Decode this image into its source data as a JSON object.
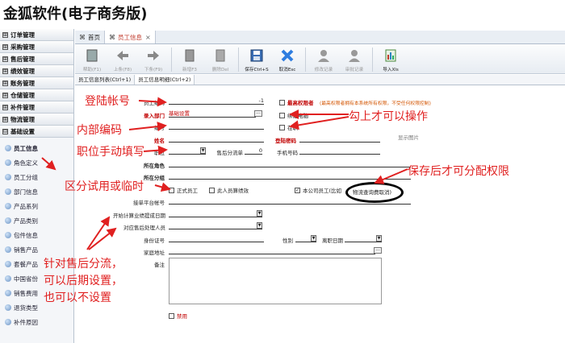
{
  "app_title": "金狐软件(电子商务版)",
  "sidebar": {
    "menus": [
      {
        "label": "订单管理",
        "sign": "⊞"
      },
      {
        "label": "采购管理",
        "sign": "⊞"
      },
      {
        "label": "售后管理",
        "sign": "⊞"
      },
      {
        "label": "绩效管理",
        "sign": "⊞"
      },
      {
        "label": "账务管理",
        "sign": "⊞"
      },
      {
        "label": "仓储管理",
        "sign": "⊞"
      },
      {
        "label": "补件管理",
        "sign": "⊞"
      },
      {
        "label": "物流管理",
        "sign": "⊞"
      },
      {
        "label": "基础设置",
        "sign": "⊟"
      }
    ],
    "sub_items": [
      "员工信息",
      "角色定义",
      "员工分组",
      "部门信息",
      "产品系列",
      "产品类别",
      "包件信息",
      "销售产品",
      "套餐产品",
      "中国省份",
      "销售费用",
      "退货类型",
      "补件原因"
    ]
  },
  "tabs": [
    {
      "label": "首页",
      "icon": "⌘",
      "active": false
    },
    {
      "label": "员工信息",
      "icon": "⌘",
      "active": true,
      "close": "×"
    }
  ],
  "toolbar": [
    {
      "label": "帮助(F1)",
      "icon": "help-book-icon",
      "enabled": false
    },
    {
      "label": "上条(F8)",
      "icon": "arrow-left-icon",
      "enabled": false
    },
    {
      "label": "下条(F9)",
      "icon": "arrow-right-icon",
      "enabled": false
    },
    {
      "label": "新增F3",
      "icon": "new-document-icon",
      "enabled": false
    },
    {
      "label": "删除Del",
      "icon": "delete-document-icon",
      "enabled": false
    },
    {
      "label": "保存Ctrl+S",
      "icon": "save-disk-icon",
      "enabled": true
    },
    {
      "label": "取消Esc",
      "icon": "cancel-x-icon",
      "enabled": true
    },
    {
      "label": "修改记录",
      "icon": "user-edit-icon",
      "enabled": false
    },
    {
      "label": "审批记录",
      "icon": "user-approve-icon",
      "enabled": false
    },
    {
      "label": "导入Xls",
      "icon": "excel-import-icon",
      "enabled": true
    }
  ],
  "subtabs": [
    "员工信息列表(Ctrl+1)",
    "员工信息明细(Ctrl+2)"
  ],
  "form": {
    "emp_code_label": "员工编码",
    "emp_code_value": "-1",
    "dept_label": "录入部门",
    "dept_value": "基础设置",
    "number_label": "编号",
    "name_label": "姓名",
    "login_pw_label": "登陆密码",
    "job_label": "职位",
    "aftersale_pipe_label": "售后分流单",
    "aftersale_pipe_value": "0",
    "mobile_label": "手机号码",
    "role_label": "所在角色",
    "group_label": "所在分组",
    "formal_label": "正式员工",
    "entry_label": "此人员算绩效",
    "company_emp_label": "本公司员工(比如",
    "logistics_label": "物流查询费取消)",
    "platform_label": "接单平台帐号",
    "calc_date_label": "开始计算业绩提成日期",
    "handler_label": "对应售后处理人员",
    "idcard_label": "身份证号",
    "gender_label": "性别",
    "leave_date_label": "离职日期",
    "address_label": "家庭地址",
    "remark_label": "备注",
    "disabled_label": "禁用",
    "top_perm_label": "最高权限者",
    "top_perm_note": "(最高权限者拥有本系统所有权限，不受任何权限控制)",
    "computer_label": "绑定电脑",
    "on_duty_label": "在职",
    "photo_label": "显示图片"
  },
  "annotations": {
    "login": "登陆帐号",
    "inner_code": "内部编码",
    "job_manual": "职位手动填写",
    "trial": "区分试用或临时",
    "aftersale": "针对售后分流，\n可以后期设置，\n也可以不设置",
    "check_ops": "勾上才可以操作",
    "after_save": "保存后才可分配权限"
  }
}
